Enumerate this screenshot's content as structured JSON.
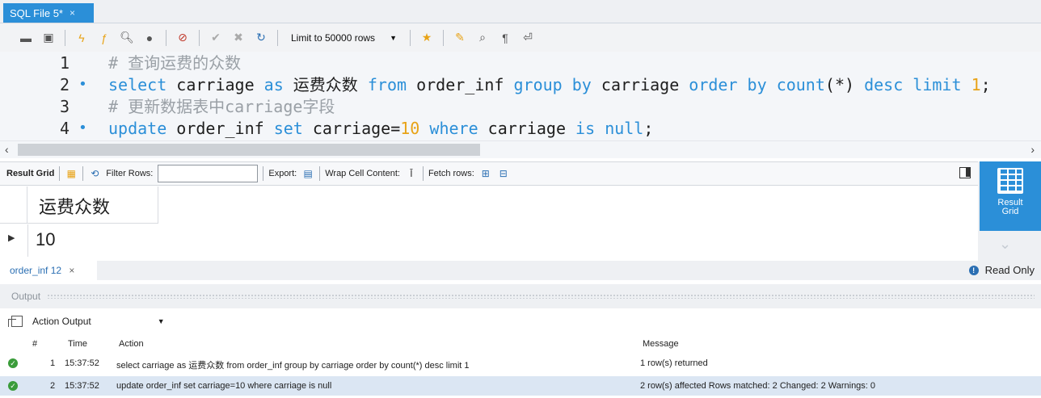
{
  "tabs": [
    {
      "label": "SQL File 5*",
      "close": "×"
    }
  ],
  "toolbar": {
    "limit_label": "Limit to 50000 rows",
    "icons": [
      "open-folder-icon",
      "save-icon",
      "execute-icon",
      "execute-current-icon",
      "explain-icon",
      "stop-icon",
      "stop-on-error-icon",
      "commit-icon",
      "rollback-icon",
      "autocommit-icon",
      "limit-dropdown",
      "bookmark-icon",
      "beautify-icon",
      "find-icon",
      "invisible-chars-icon",
      "wrap-icon"
    ]
  },
  "editor": {
    "lines": [
      {
        "num": "1",
        "dot": false,
        "text": "# 查询运费的众数"
      },
      {
        "num": "2",
        "dot": true,
        "text": "select carriage as 运费众数 from order_inf group by carriage order by count(*) desc limit 1;"
      },
      {
        "num": "3",
        "dot": false,
        "text": "# 更新数据表中carriage字段"
      },
      {
        "num": "4",
        "dot": true,
        "text": "update order_inf set carriage=10 where carriage is null;"
      }
    ]
  },
  "result_toolbar": {
    "result_grid": "Result Grid",
    "filter_rows": "Filter Rows:",
    "export": "Export:",
    "wrap_cell": "Wrap Cell Content:",
    "fetch_rows": "Fetch rows:"
  },
  "grid": {
    "columns": [
      "运费众数"
    ],
    "rows": [
      [
        "10"
      ]
    ]
  },
  "side_panel": {
    "label_line1": "Result",
    "label_line2": "Grid"
  },
  "result_tabs": {
    "tab_label": "order_inf 12",
    "close": "×",
    "read_only": "Read Only"
  },
  "output": {
    "title": "Output",
    "selector": "Action Output",
    "columns": {
      "num": "#",
      "time": "Time",
      "action": "Action",
      "message": "Message"
    },
    "rows": [
      {
        "num": "1",
        "time": "15:37:52",
        "action": "select carriage as 运费众数 from order_inf group by carriage order by count(*) desc limit 1",
        "message": "1 row(s) returned"
      },
      {
        "num": "2",
        "time": "15:37:52",
        "action": "update order_inf set carriage=10 where carriage is null",
        "message": "2 row(s) affected Rows matched: 2  Changed: 2  Warnings: 0"
      }
    ]
  },
  "colors": {
    "accent": "#2b8fd8",
    "keyword": "#2b8fd8",
    "comment": "#9aa0a6",
    "number": "#e8a317",
    "success": "#3a9c3a",
    "selected_row": "#dbe6f3"
  }
}
